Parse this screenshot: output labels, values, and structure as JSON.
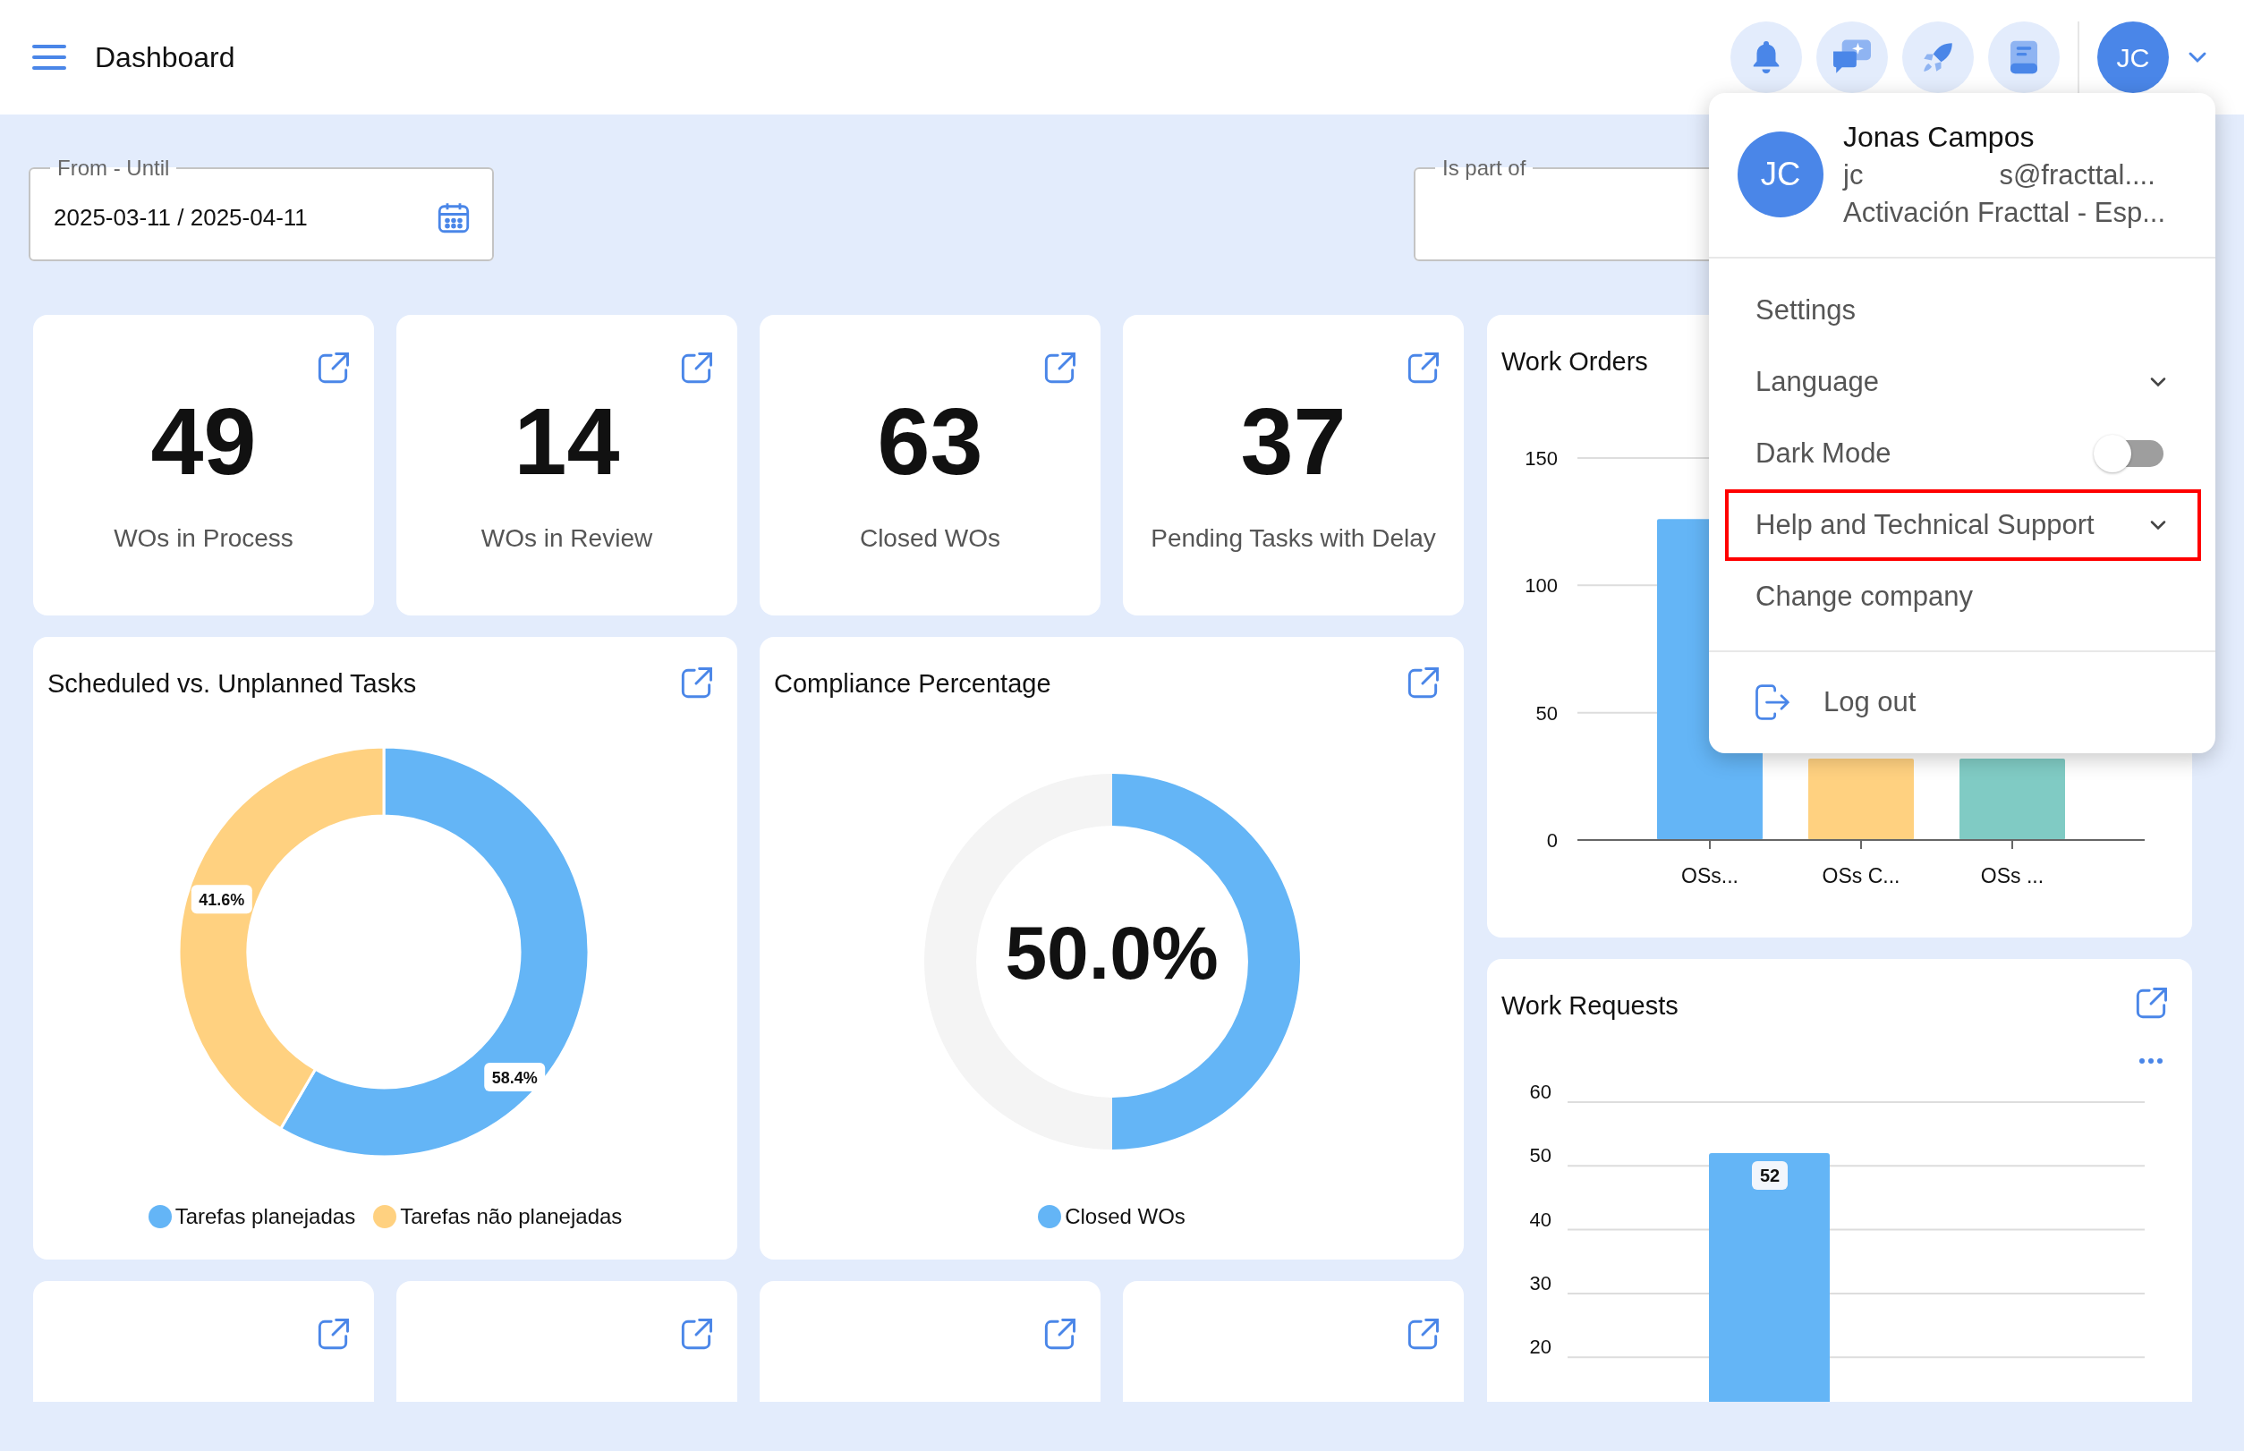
{
  "header": {
    "title": "Dashboard",
    "avatar": "JC"
  },
  "filters": [
    {
      "label": "From - Until",
      "value": "2025-03-11 / 2025-04-11",
      "kind": "date"
    },
    {
      "label": "Is part of",
      "kind": "select"
    }
  ],
  "kpi_cards": [
    {
      "value": "49",
      "label": "WOs in Process"
    },
    {
      "value": "14",
      "label": "WOs in Review"
    },
    {
      "value": "63",
      "label": "Closed WOs"
    },
    {
      "value": "37",
      "label": "Pending Tasks with Delay"
    }
  ],
  "work_orders": {
    "title": "Work Orders",
    "chart_data": {
      "type": "bar",
      "categories": [
        "OSs...",
        "OSs C...",
        "OSs ..."
      ],
      "series": [
        {
          "color": "#64b5f6",
          "values": [
            126,
            null,
            null
          ]
        },
        {
          "color": "#ffd180",
          "values": [
            null,
            32,
            null
          ]
        },
        {
          "color": "#80cbc4",
          "values": [
            null,
            null,
            32
          ]
        }
      ],
      "ylim": [
        0,
        150
      ],
      "yticks": [
        0,
        50,
        100,
        150
      ],
      "grid": true
    }
  },
  "scheduled": {
    "title": "Scheduled vs. Unplanned Tasks",
    "chart_data": {
      "type": "donut",
      "categories": [
        "Tarefas planejadas",
        "Tarefas não planejadas"
      ],
      "series": [
        {
          "values": [
            58.4,
            41.6
          ]
        }
      ],
      "colors": [
        "#64b5f6",
        "#ffd180"
      ],
      "value_labels": [
        "58.4%",
        "41.6%"
      ]
    }
  },
  "compliance": {
    "title": "Compliance Percentage",
    "center": "50.0%",
    "chart_data": {
      "type": "donut",
      "categories": [
        "Closed WOs",
        null
      ],
      "series": [
        {
          "values": [
            50,
            50
          ]
        }
      ],
      "colors": [
        "#64b5f6",
        "#f4f4f4"
      ]
    }
  },
  "work_requests": {
    "title": "Work Requests",
    "chart_data": {
      "type": "bar",
      "series": [
        {
          "color": "#64b5f6",
          "values": [
            52
          ]
        }
      ],
      "ylim": [
        0,
        60
      ],
      "yticks": [
        20,
        30,
        40,
        50,
        60
      ],
      "grid": true,
      "value_labels": [
        "52"
      ]
    }
  },
  "menu": {
    "avatar": "JC",
    "name": "Jonas Campos",
    "email_parts": [
      "jc",
      "s@fracttal...."
    ],
    "company": "Activación Fracttal - Esp...",
    "items": [
      {
        "label": "Settings",
        "kind": "link",
        "highlighted": false
      },
      {
        "label": "Language",
        "kind": "expand",
        "highlighted": false
      },
      {
        "label": "Dark Mode",
        "kind": "toggle",
        "on": false,
        "highlighted": false
      },
      {
        "label": "Help and Technical Support",
        "kind": "expand",
        "highlighted": true
      },
      {
        "label": "Change company",
        "kind": "link",
        "highlighted": false
      }
    ],
    "logout": "Log out"
  }
}
